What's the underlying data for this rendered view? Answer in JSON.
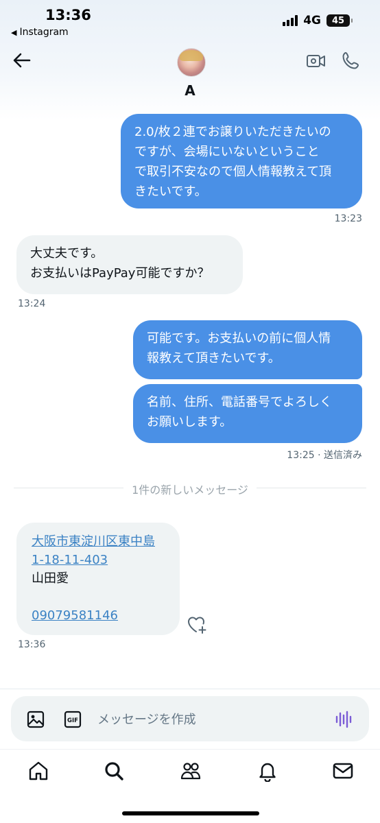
{
  "status_bar": {
    "time": "13:36",
    "back_app": "Instagram",
    "network": "4G",
    "battery": "45"
  },
  "header": {
    "contact_name": "A"
  },
  "messages": [
    {
      "direction": "outgoing",
      "lines": [
        "2.0/枚２連でお譲りいただきたいの",
        "ですが、会場にいないということ",
        "で取引不安なので個人情報教えて頂",
        "きたいです。"
      ],
      "time": "13:23"
    },
    {
      "direction": "incoming",
      "lines": [
        "大丈夫です。",
        "お支払いはPayPay可能ですか？"
      ],
      "time": "13:24"
    },
    {
      "direction": "outgoing",
      "lines": [
        "可能です。お支払いの前に個人情",
        "報教えて頂きたいです。"
      ]
    },
    {
      "direction": "outgoing",
      "lines": [
        "名前、住所、電話番号でよろしく",
        "お願いします。"
      ],
      "time": "13:25 · 送信済み"
    }
  ],
  "new_message_divider": "1件の新しいメッセージ",
  "last_message": {
    "address_line1": "大阪市東淀川区東中島",
    "address_line2": "1-18-11-403",
    "name": "山田愛",
    "phone": "09079581146",
    "time": "13:36"
  },
  "composer": {
    "placeholder": "メッセージを作成",
    "gif_label": "GIF"
  },
  "colors": {
    "outgoing_bubble": "#4a90e6",
    "incoming_bubble": "#eff3f4",
    "link": "#3b82c4"
  },
  "nav": [
    "home-icon",
    "search-icon",
    "communities-icon",
    "notifications-icon",
    "messages-icon"
  ]
}
